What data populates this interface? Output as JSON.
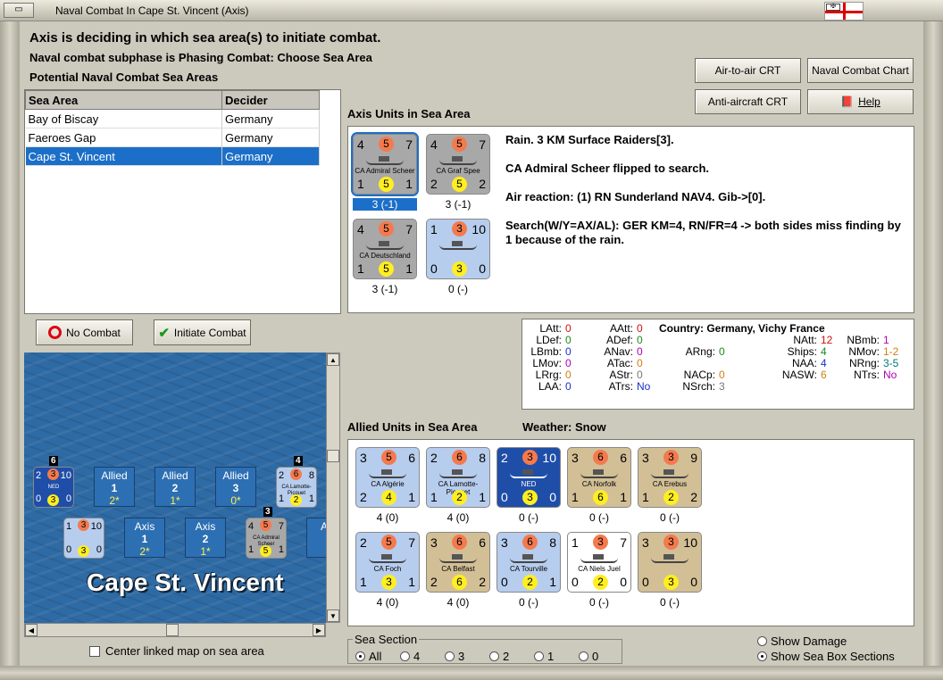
{
  "window": {
    "title": "Naval Combat In Cape St. Vincent (Axis)",
    "icon_label": "▭"
  },
  "status": {
    "line1": "Axis is deciding in which sea area(s) to initiate combat.",
    "line2": "Naval combat subphase is Phasing Combat: Choose Sea Area",
    "line3": "Potential Naval Combat Sea Areas"
  },
  "buttons": {
    "air_to_air": "Air-to-air CRT",
    "naval_chart": "Naval Combat Chart",
    "anti_aircraft": "Anti-aircraft CRT",
    "help": "Help",
    "no_combat": "No Combat",
    "initiate": "Initiate Combat"
  },
  "sea_table": {
    "headers": [
      "Sea Area",
      "Decider"
    ],
    "rows": [
      {
        "area": "Bay of Biscay",
        "decider": "Germany"
      },
      {
        "area": "Faeroes Gap",
        "decider": "Germany"
      },
      {
        "area": "Cape St. Vincent",
        "decider": "Germany"
      }
    ]
  },
  "axis_section": {
    "title": "Axis Units in Sea Area"
  },
  "axis_units": [
    {
      "tl": "4",
      "tc": "5",
      "tr": "7",
      "name": "CA Admiral Scheer",
      "bl": "1",
      "bc": "5",
      "br": "1",
      "label": "3 (-1)",
      "bg": "#a8a8a8"
    },
    {
      "tl": "4",
      "tc": "5",
      "tr": "7",
      "name": "CA Graf Spee",
      "bl": "2",
      "bc": "5",
      "br": "2",
      "label": "3 (-1)",
      "bg": "#a8a8a8"
    },
    {
      "tl": "4",
      "tc": "5",
      "tr": "7",
      "name": "CA Deutschland",
      "bl": "1",
      "bc": "5",
      "br": "1",
      "label": "3 (-1)",
      "bg": "#a8a8a8"
    },
    {
      "tl": "1",
      "tc": "3",
      "tr": "10",
      "name": "",
      "bl": "0",
      "bc": "3",
      "br": "0",
      "label": "0 (-)",
      "bg": "#b7cdee"
    }
  ],
  "log": [
    "Rain.  3 KM Surface Raiders[3].",
    "CA Admiral Scheer flipped to search.",
    "Air reaction:  (1) RN Sunderland NAV4.  Gib->[0].",
    "Search(W/Y=AX/AL):  GER KM=4, RN/FR=4 -> both sides miss finding by 1 because of the rain."
  ],
  "stats": {
    "country_label": "Country: Germany, Vichy France",
    "col1": [
      [
        "LAtt:",
        "0"
      ],
      [
        "LDef:",
        "0"
      ],
      [
        "LBmb:",
        "0"
      ],
      [
        "LMov:",
        "0"
      ],
      [
        "LRrg:",
        "0"
      ],
      [
        "LAA:",
        "0"
      ]
    ],
    "col2": [
      [
        "AAtt:",
        "0"
      ],
      [
        "ADef:",
        "0"
      ],
      [
        "ANav:",
        "0"
      ],
      [
        "ATac:",
        "0"
      ],
      [
        "AStr:",
        "0"
      ],
      [
        "ATrs:",
        "No"
      ]
    ],
    "col3": [
      [
        "ARng:",
        "0"
      ],
      [
        "NACp:",
        "0"
      ],
      [
        "NSrch:",
        "3"
      ]
    ],
    "col4": [
      [
        "NAtt:",
        "12"
      ],
      [
        "Ships:",
        "4"
      ],
      [
        "NAA:",
        "4"
      ],
      [
        "NASW:",
        "6"
      ]
    ],
    "col5": [
      [
        "NBmb:",
        "1"
      ],
      [
        "NMov:",
        "1-2"
      ],
      [
        "NRng:",
        "3-5"
      ],
      [
        "NTrs:",
        "No"
      ]
    ],
    "colors": {
      "red": "#d01010",
      "green": "#1a8a1a",
      "blue": "#1a2fcc",
      "purple": "#b000b0",
      "orange": "#d08010",
      "gray": "#777777",
      "teal": "#007a7a"
    }
  },
  "allied_section": {
    "title": "Allied Units in Sea Area",
    "weather": "Weather:  Snow"
  },
  "allied_units": [
    {
      "tl": "3",
      "tc": "5",
      "tr": "6",
      "name": "CA Algérie",
      "bl": "2",
      "bc": "4",
      "br": "1",
      "label": "4 (0)",
      "bg": "#b7cdee"
    },
    {
      "tl": "2",
      "tc": "6",
      "tr": "8",
      "name": "CA Lamotte-Picquet",
      "bl": "1",
      "bc": "2",
      "br": "1",
      "label": "4 (0)",
      "bg": "#b7cdee"
    },
    {
      "tl": "2",
      "tc": "3",
      "tr": "10",
      "name": "NED",
      "bl": "0",
      "bc": "3",
      "br": "0",
      "label": "0 (-)",
      "bg": "#1f4ea8"
    },
    {
      "tl": "3",
      "tc": "6",
      "tr": "6",
      "name": "CA Norfolk",
      "bl": "1",
      "bc": "6",
      "br": "1",
      "label": "0 (-)",
      "bg": "#d2bf96"
    },
    {
      "tl": "3",
      "tc": "3",
      "tr": "9",
      "name": "CA Erebus",
      "bl": "1",
      "bc": "2",
      "br": "2",
      "label": "0 (-)",
      "bg": "#d2bf96"
    },
    {
      "tl": "2",
      "tc": "5",
      "tr": "7",
      "name": "CA Foch",
      "bl": "1",
      "bc": "3",
      "br": "1",
      "label": "4 (0)",
      "bg": "#b7cdee"
    },
    {
      "tl": "3",
      "tc": "6",
      "tr": "6",
      "name": "CA Belfast",
      "bl": "2",
      "bc": "6",
      "br": "2",
      "label": "4 (0)",
      "bg": "#d2bf96"
    },
    {
      "tl": "3",
      "tc": "6",
      "tr": "8",
      "name": "CA Tourville",
      "bl": "0",
      "bc": "2",
      "br": "1",
      "label": "0 (-)",
      "bg": "#b7cdee"
    },
    {
      "tl": "1",
      "tc": "3",
      "tr": "7",
      "name": "CA Niels Juel",
      "bl": "0",
      "bc": "2",
      "br": "0",
      "label": "0 (-)",
      "bg": "#ffffff"
    },
    {
      "tl": "3",
      "tc": "3",
      "tr": "10",
      "name": "",
      "bl": "0",
      "bc": "3",
      "br": "0",
      "label": "0 (-)",
      "bg": "#d2bf96"
    }
  ],
  "map": {
    "name": "Cape St. Vincent",
    "allied_boxes": [
      {
        "t": "Allied",
        "n": "1",
        "v": "2*"
      },
      {
        "t": "Allied",
        "n": "2",
        "v": "1*"
      },
      {
        "t": "Allied",
        "n": "3",
        "v": "0*"
      }
    ],
    "axis_boxes": [
      {
        "t": "Axis",
        "n": "1",
        "v": "2*"
      },
      {
        "t": "Axis",
        "n": "2",
        "v": "1*"
      },
      {
        "t": "Ax",
        "n": "",
        "v": ""
      }
    ],
    "stack_counts": [
      "6",
      "4",
      "3"
    ],
    "ned_counter": {
      "tl": "2",
      "tc": "3",
      "tr": "10",
      "name": "NED",
      "bl": "0",
      "bc": "3",
      "br": "0"
    },
    "lamotte_counter": {
      "tl": "2",
      "tc": "6",
      "tr": "8",
      "name": "CA Lamotte-Picquet",
      "bl": "1",
      "bc": "2",
      "br": "1"
    },
    "axis_counter1": {
      "tl": "1",
      "tc": "3",
      "tr": "10",
      "name": "",
      "bl": "0",
      "bc": "3",
      "br": "0"
    },
    "scheer_counter": {
      "tl": "4",
      "tc": "5",
      "tr": "7",
      "name": "CA Admiral Scheer",
      "bl": "1",
      "bc": "5",
      "br": "1"
    }
  },
  "center_map_label": "Center linked map on sea area",
  "sea_section": {
    "title": "Sea Section",
    "options": [
      "All",
      "4",
      "3",
      "2",
      "1",
      "0"
    ],
    "selected": "All"
  },
  "display_options": {
    "show_damage": "Show Damage",
    "show_sections": "Show Sea Box Sections",
    "selected": "show_sections"
  }
}
